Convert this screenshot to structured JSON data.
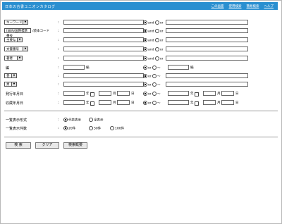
{
  "header": {
    "title": "日本の古書ユニオンカタログ",
    "nav": [
      "この画面",
      "使用検索",
      "簡易検索",
      "ヘルプ"
    ]
  },
  "fields": {
    "keyword_select": "キーワード",
    "isbn_select": "ISBN/国際標準番号",
    "isbn_label": "/読本コード",
    "title_select": "主要な",
    "bunsho_select": "文書番号",
    "author_select": "著者",
    "hen_label": "編",
    "hen_unit": "編",
    "sel_a": "巻",
    "sel_b": "頁",
    "pub_date_label": "発行年月日",
    "reg_date_label": "収蔵年月日",
    "year": "年",
    "month": "月",
    "day": "日",
    "and_label": "and",
    "or_label": "or",
    "tilde_label": "〜"
  },
  "display": {
    "format_label": "一覧表示形式",
    "format_options": [
      "代表表示",
      "全表示"
    ],
    "count_label": "一覧表示件数",
    "count_options": [
      "20件",
      "50件",
      "100件"
    ]
  },
  "buttons": {
    "search": "検 索",
    "clear": "クリア",
    "help": "検索概要"
  }
}
